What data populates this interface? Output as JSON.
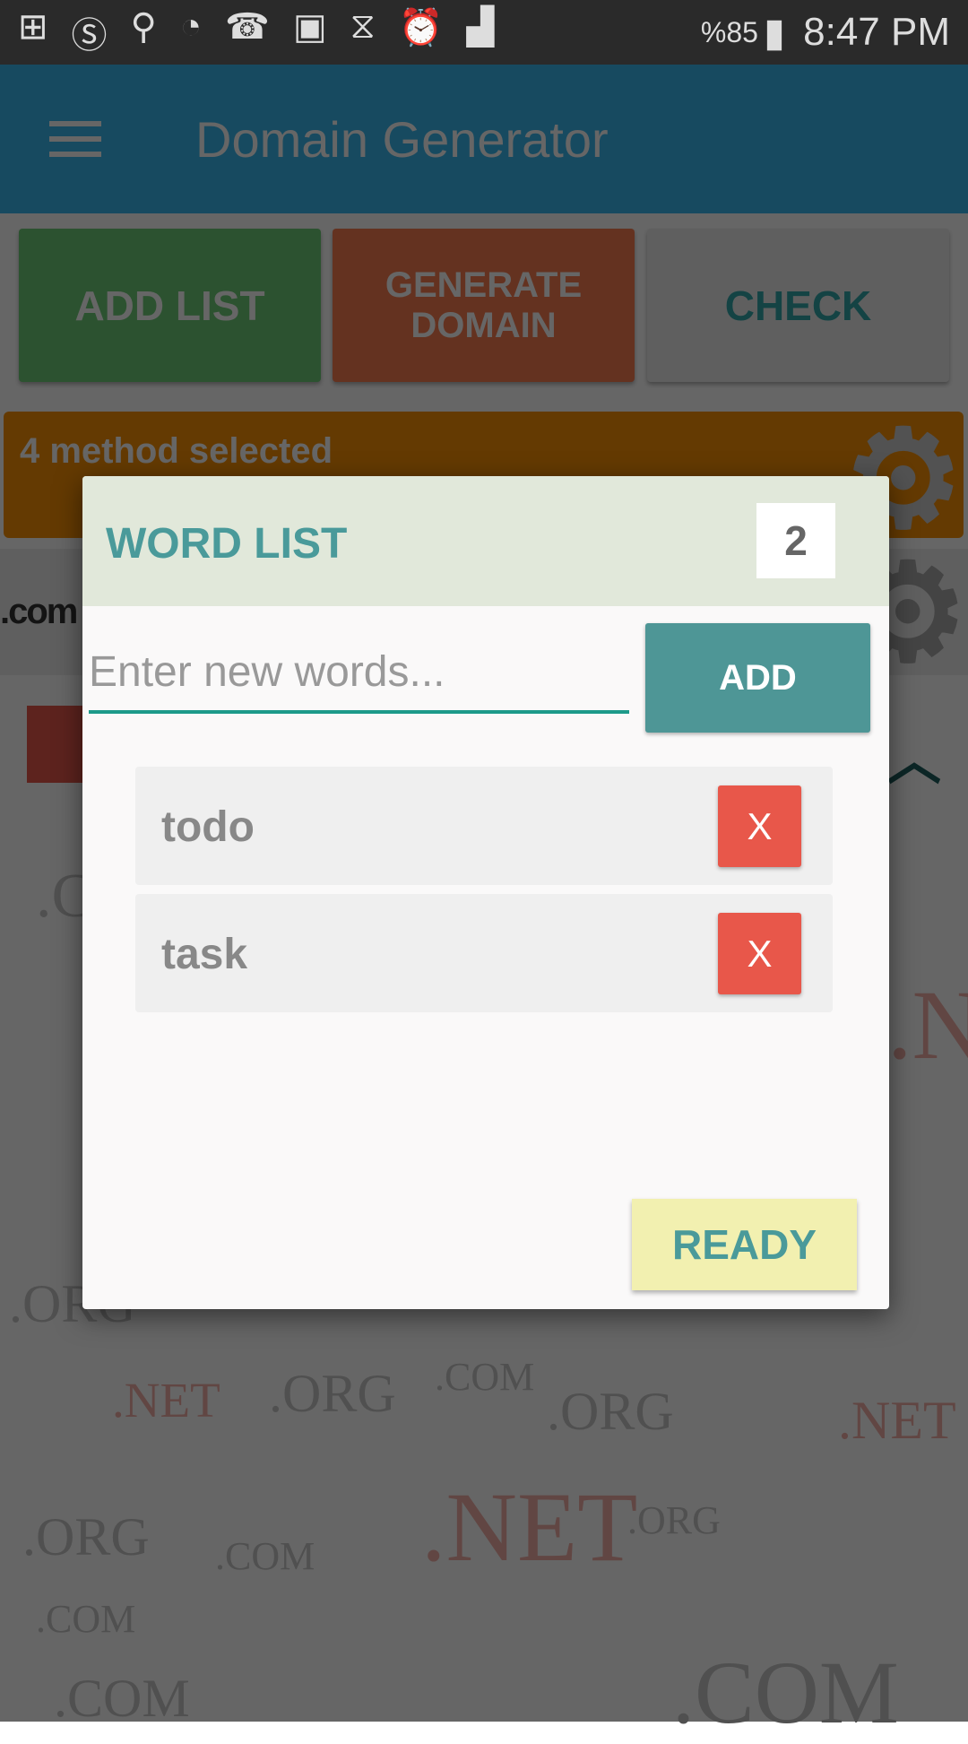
{
  "status_bar": {
    "battery": "%85",
    "time": "8:47 PM"
  },
  "app_bar": {
    "title": "Domain Generator"
  },
  "actions": {
    "add_list": "ADD LIST",
    "generate_line1": "GENERATE",
    "generate_line2": "DOMAIN",
    "check": "CHECK"
  },
  "methods": {
    "label": "4 method selected"
  },
  "tld": {
    "label": ".com"
  },
  "watermark": [
    ".COM",
    ".ORG",
    ".NET"
  ],
  "dialog": {
    "title": "WORD LIST",
    "count": "2",
    "input_placeholder": "Enter new words...",
    "input_value": "",
    "add_label": "ADD",
    "words": [
      {
        "label": "todo",
        "remove": "X"
      },
      {
        "label": "task",
        "remove": "X"
      }
    ],
    "ready_label": "READY"
  },
  "colors": {
    "accent": "#4a9a9a",
    "remove": "#e8574a",
    "add_list": "#6fcd78",
    "generate": "#fa7d50",
    "methods": "#fa9105",
    "app_bar": "#3abaf0",
    "ready": "#f2f0b0"
  }
}
